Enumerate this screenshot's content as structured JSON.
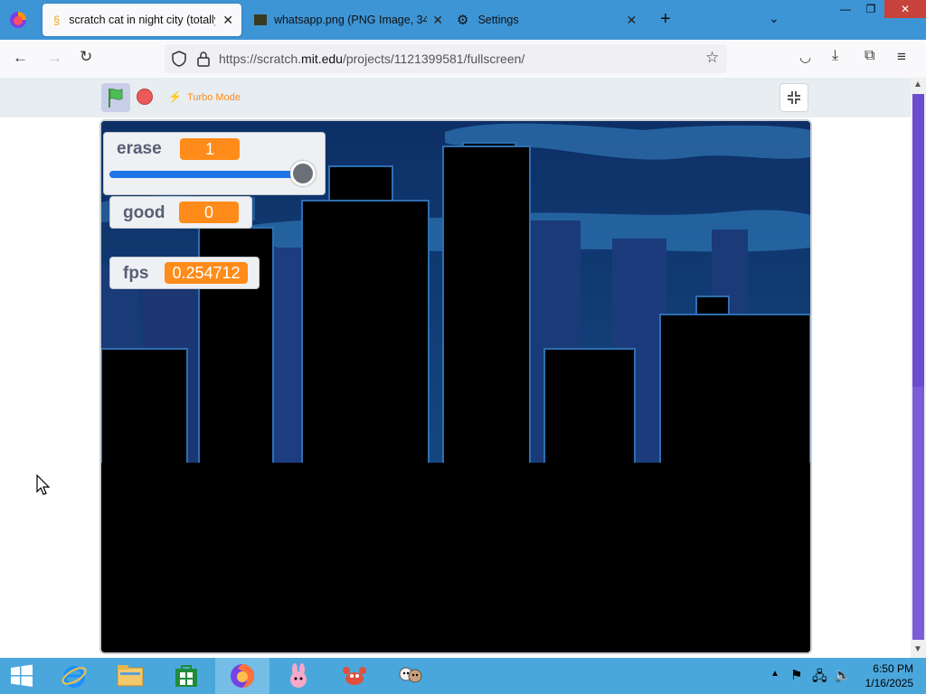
{
  "browser": {
    "tabs": [
      {
        "label": "scratch cat in night city (totally",
        "active": true
      },
      {
        "label": "whatsapp.png (PNG Image, 34",
        "active": false
      },
      {
        "label": "Settings",
        "active": false
      }
    ],
    "url_prefix": "https://scratch.",
    "url_domain": "mit.edu",
    "url_path": "/projects/1121399581/fullscreen/"
  },
  "scratch": {
    "turbo_label": "Turbo Mode",
    "monitors": [
      {
        "label": "erase",
        "value": "1",
        "slider_fraction": 1.0
      },
      {
        "label": "good",
        "value": "0"
      },
      {
        "label": "fps",
        "value": "0.254712"
      }
    ]
  },
  "taskbar": {
    "time": "6:50 PM",
    "date": "1/16/2025"
  },
  "colors": {
    "browser_accent": "#3d95d6",
    "scratch_orange": "#ff8c1a",
    "stop_red": "#ec5959",
    "flag_green": "#4cbf56"
  }
}
